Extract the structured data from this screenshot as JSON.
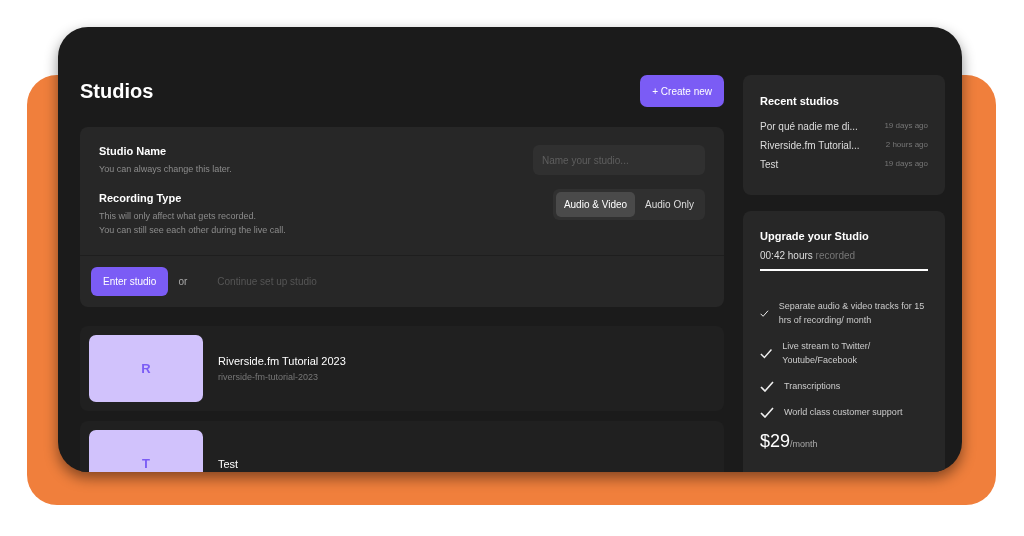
{
  "header": {
    "title": "Studios",
    "create_button": "+ Create new"
  },
  "setup": {
    "name_label": "Studio Name",
    "name_hint": "You can always change this later.",
    "name_placeholder": "Name your studio...",
    "type_label": "Recording Type",
    "type_hints": [
      "This will only affect what gets recorded.",
      "You can still see each other during the live call."
    ],
    "type_options": [
      {
        "label": "Audio & Video",
        "selected": true
      },
      {
        "label": "Audio Only",
        "selected": false
      }
    ],
    "enter_button": "Enter studio",
    "or": "or",
    "continue_link": "Continue set up studio"
  },
  "studios": [
    {
      "initial": "R",
      "name": "Riverside.fm Tutorial 2023",
      "slug": "riverside-fm-tutorial-2023"
    },
    {
      "initial": "T",
      "name": "Test"
    }
  ],
  "recent": {
    "title": "Recent studios",
    "items": [
      {
        "name": "Por qué nadie me di...",
        "time": "19 days ago"
      },
      {
        "name": "Riverside.fm Tutorial...",
        "time": "2 hours ago"
      },
      {
        "name": "Test",
        "time": "19 days ago"
      }
    ]
  },
  "upgrade": {
    "title": "Upgrade your Studio",
    "hours": "00:42 hours",
    "recorded": "recorded",
    "level": 1,
    "features": [
      "Separate audio & video tracks for 15 hrs of recording/ month",
      "Live stream to Twitter/ Youtube/Facebook",
      "Transcriptions",
      "World class customer support"
    ],
    "price": "$29",
    "period": "/month"
  }
}
